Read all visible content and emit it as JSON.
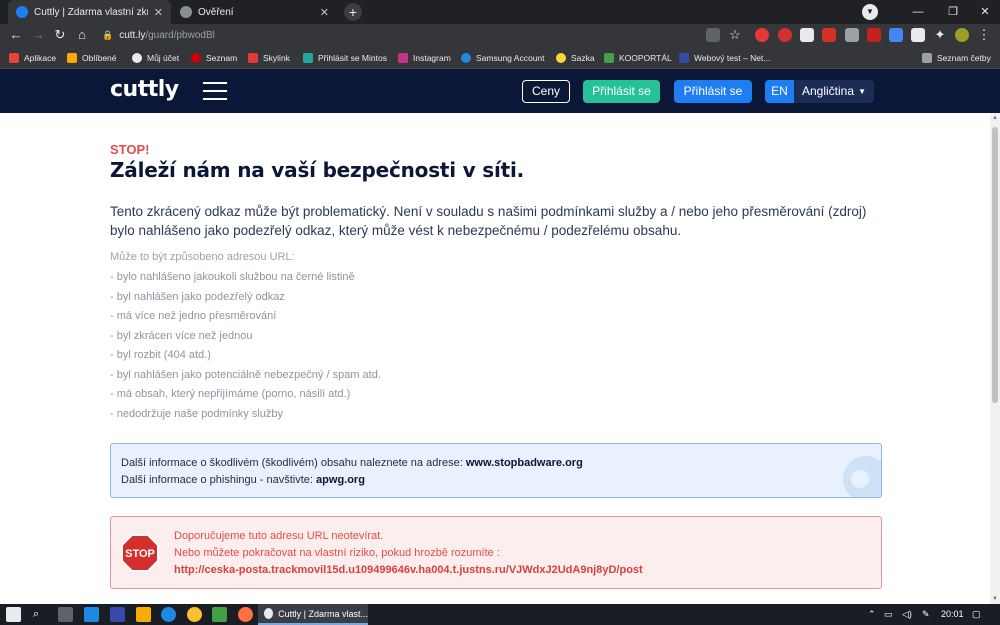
{
  "browser": {
    "tabs": [
      {
        "title": "Cuttly | Zdarma vlastní zkracovač",
        "active": true
      },
      {
        "title": "Ověření",
        "active": false
      }
    ],
    "window_controls": {
      "minimize": "—",
      "restore": "❐",
      "close": "✕"
    },
    "url": {
      "domain": "cutt.ly",
      "path": "/guard/pbwodBl"
    },
    "bookmarks": [
      "Aplikace",
      "Oblíbené",
      "Můj účet",
      "Seznam",
      "Skylink",
      "Přihlásit se Mintos",
      "Instagram",
      "Samsung Account",
      "Sazka",
      "KOOPORTÁL",
      "Webový test – Net..."
    ],
    "reading_list": "Seznam četby"
  },
  "site": {
    "logo": "cuttly",
    "buttons": {
      "prices": "Ceny",
      "login_green": "Přihlásit se",
      "login_blue": "Přihlásit se"
    },
    "lang": {
      "code": "EN",
      "name": "Angličtina"
    }
  },
  "page": {
    "stop_label": "STOP!",
    "headline": "Záleží nám na vaší bezpečnosti v síti.",
    "intro": "Tento zkrácený odkaz může být problematický. Není v souladu s našimi podmínkami služby a / nebo jeho přesměrování (zdroj) bylo nahlášeno jako podezřelý odkaz, který může vést k nebezpečnému / podezřelému obsahu.",
    "reasons_title": "Může to být způsobeno adresou URL:",
    "reasons": [
      "- bylo nahlášeno jakoukoli službou na černé listině",
      "- byl nahlášen jako podezřelý odkaz",
      "- má více než jedno přesměrování",
      "- byl zkrácen více než jednou",
      "- byl rozbit (404 atd.)",
      "- byl nahlášen jako potenciálně nebezpečný / spam atd.",
      "- má obsah, který nepřijímáme (porno, násilí atd.)",
      "- nedodržuje naše podmínky služby"
    ],
    "info": {
      "line1_text": "Další informace o škodlivém (škodlivém) obsahu naleznete na adrese: ",
      "line1_link": "www.stopbadware.org",
      "line2_text": "Další informace o phishingu - navštivte: ",
      "line2_link": "apwg.org"
    },
    "warning": {
      "sign_text": "STOP",
      "line1": "Doporučujeme tuto adresu URL neotevírat.",
      "line2": "Nebo můžete pokračovat na vlastní riziko, pokud hrozbě rozumíte :",
      "link": "http://ceska-posta.trackmovil15d.u109499646v.ha004.t.justns.ru/VJWdxJ2UdA9nj8yD/post"
    }
  },
  "taskbar": {
    "active_task": "Cuttly | Zdarma vlast...",
    "time": "20:01"
  },
  "colors": {
    "header_bg": "#0b1736",
    "accent_green": "#25c197",
    "accent_blue": "#1f7df2",
    "danger": "#e24c4b"
  }
}
